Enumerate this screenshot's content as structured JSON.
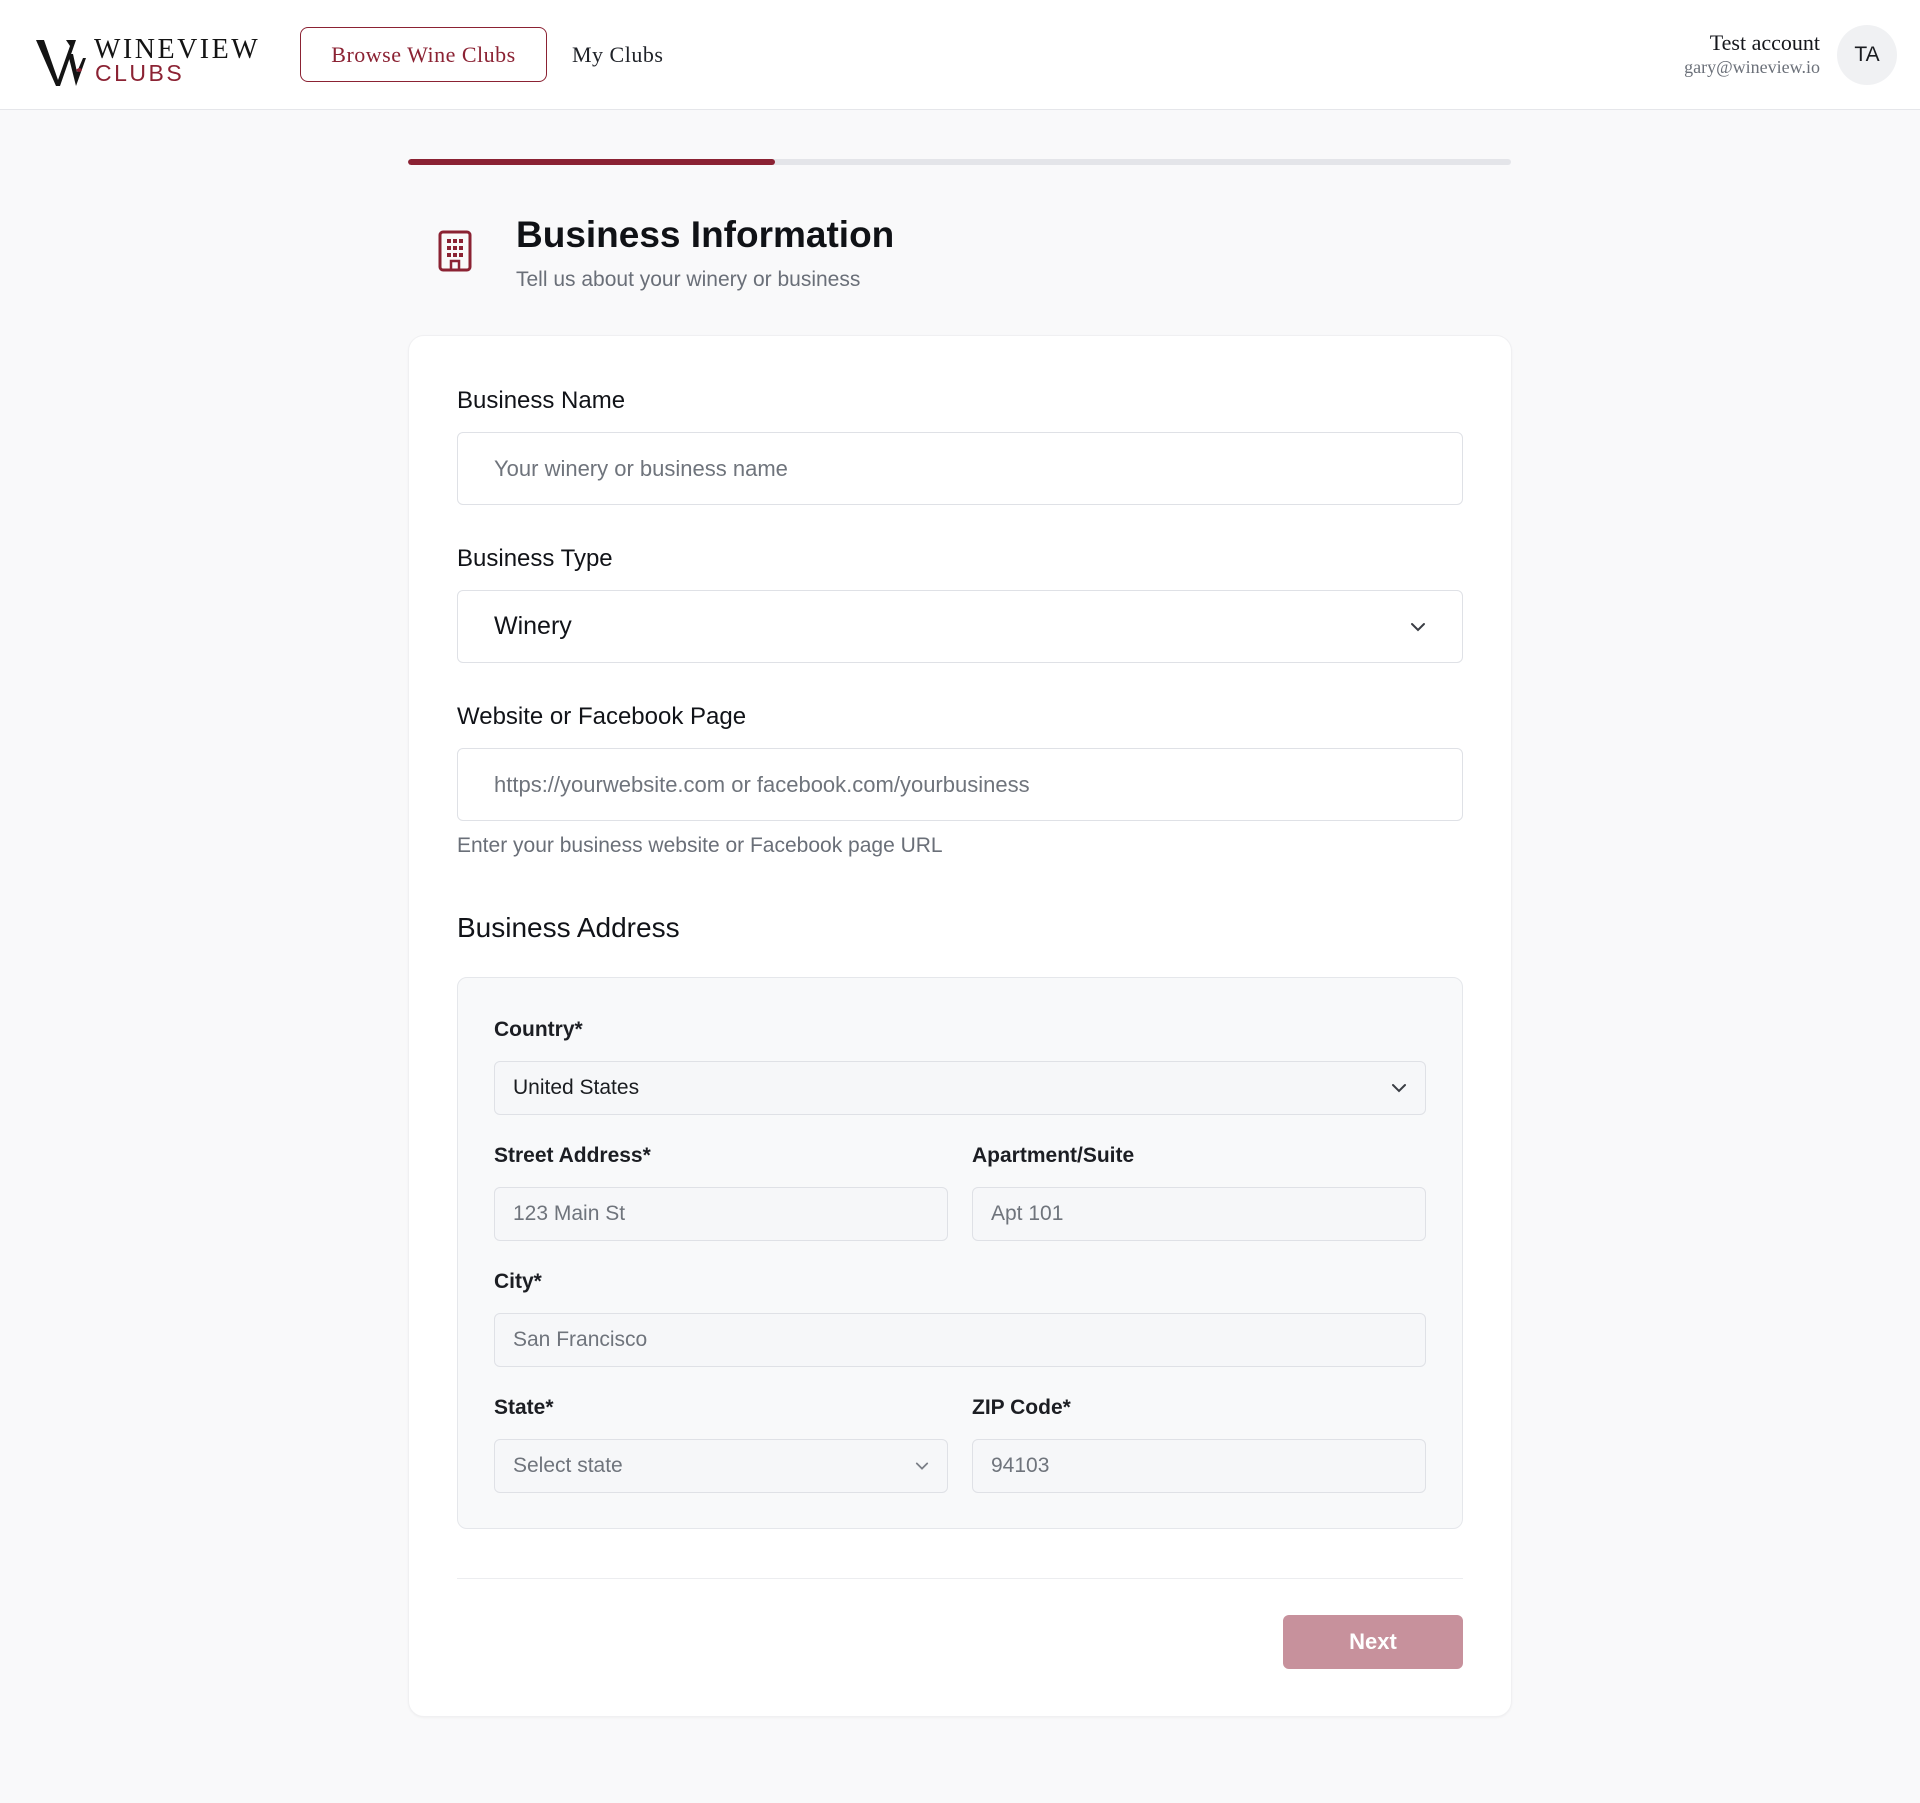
{
  "header": {
    "logo": {
      "line1": "WINEVIEW",
      "line2": "CLUBS"
    },
    "nav": {
      "browse_label": "Browse Wine Clubs",
      "my_clubs_label": "My Clubs"
    },
    "user": {
      "name": "Test account",
      "email": "gary@wineview.io",
      "initials": "TA"
    }
  },
  "progress": {
    "current_step": 1,
    "fraction_complete": 0.333
  },
  "step": {
    "icon": "building-icon",
    "title": "Business Information",
    "subtitle": "Tell us about your winery or business"
  },
  "form": {
    "business_name": {
      "label": "Business Name",
      "placeholder": "Your winery or business name",
      "value": ""
    },
    "business_type": {
      "label": "Business Type",
      "value": "Winery"
    },
    "website": {
      "label": "Website or Facebook Page",
      "placeholder": "https://yourwebsite.com or facebook.com/yourbusiness",
      "help": "Enter your business website or Facebook page URL"
    },
    "address": {
      "title": "Business Address",
      "country": {
        "label": "Country*",
        "value": "United States"
      },
      "street": {
        "label": "Street Address*",
        "placeholder": "123 Main St"
      },
      "apartment": {
        "label": "Apartment/Suite",
        "placeholder": "Apt 101"
      },
      "city": {
        "label": "City*",
        "placeholder": "San Francisco"
      },
      "state": {
        "label": "State*",
        "placeholder": "Select state"
      },
      "zip": {
        "label": "ZIP Code*",
        "placeholder": "94103"
      }
    },
    "next_label": "Next"
  },
  "colors": {
    "brand": "#8b2233",
    "next_button_disabled": "#c7919c",
    "progress_track": "#e4e5e9"
  }
}
